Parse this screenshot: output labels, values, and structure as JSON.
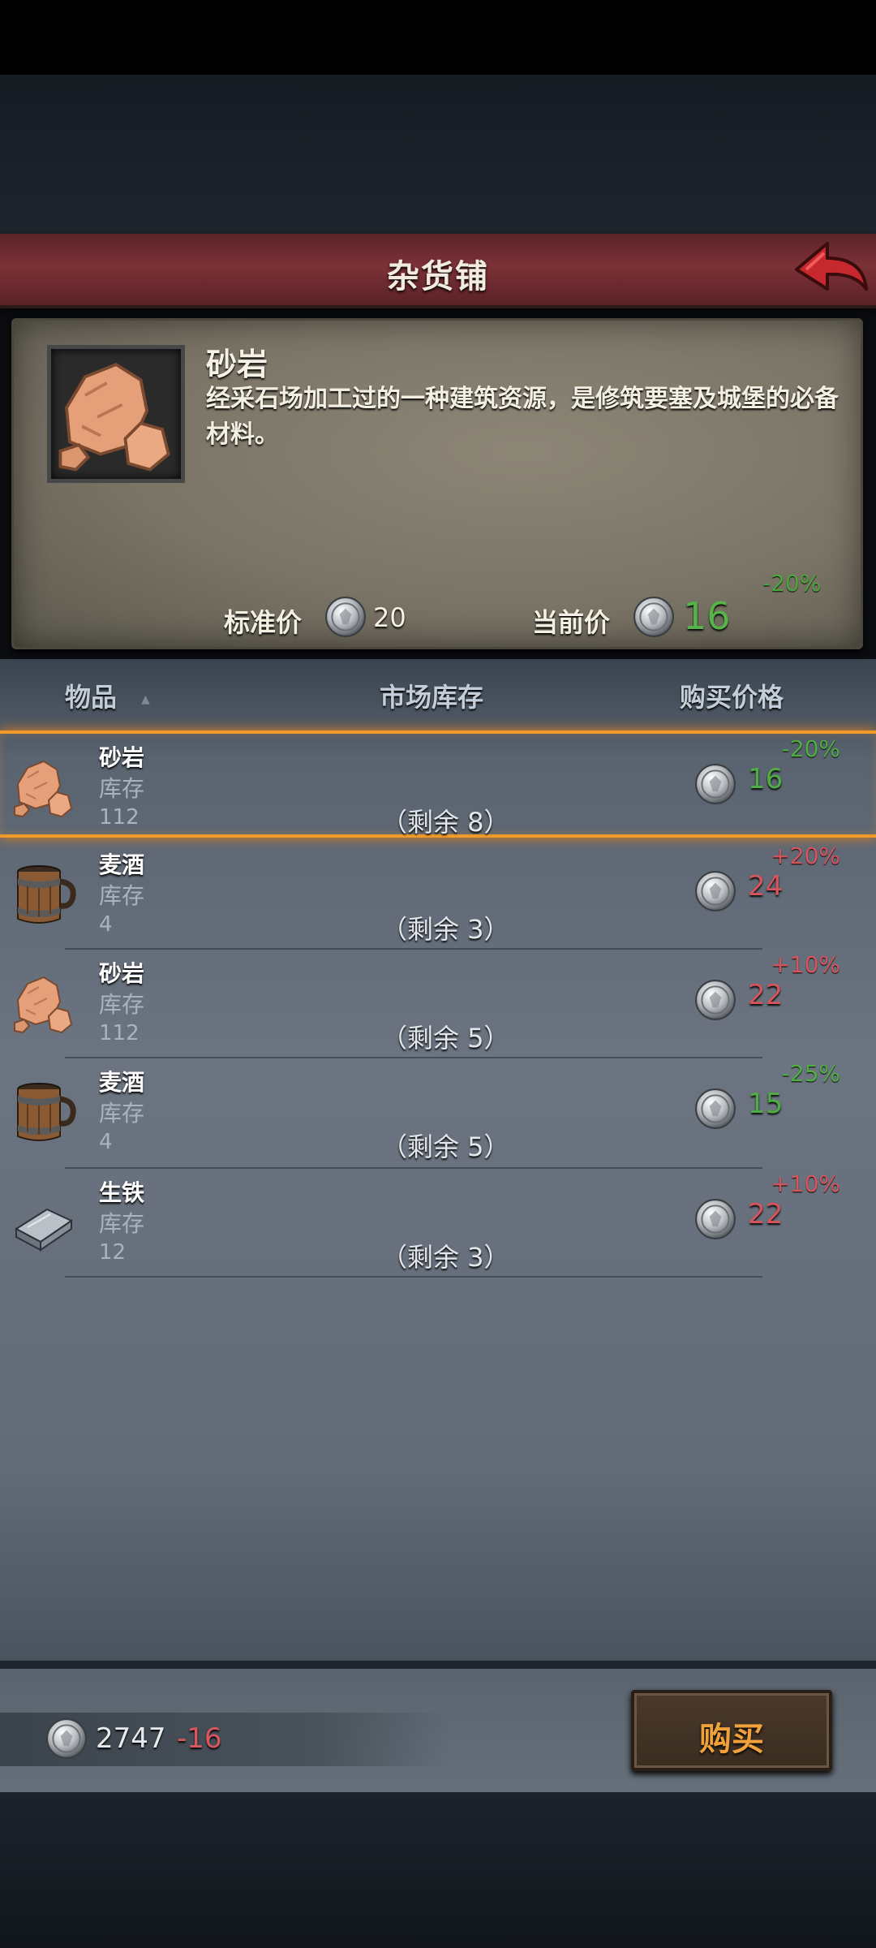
{
  "shop": {
    "title": "杂货铺"
  },
  "detail": {
    "name": "砂岩",
    "description": "经采石场加工过的一种建筑资源，是修筑要塞及城堡的必备材料。",
    "discount": "-20%",
    "standard_price_label": "标准价",
    "standard_price": "20",
    "current_price_label": "当前价",
    "current_price": "16",
    "icon": "sandstone-icon"
  },
  "columns": {
    "item": "物品",
    "stock": "市场库存",
    "price": "购买价格"
  },
  "items": [
    {
      "name": "砂岩",
      "stock_label": "库存",
      "stock": "112",
      "remain": "（剩余 8）",
      "pct": "-20%",
      "price": "16",
      "trend": "down",
      "icon": "sandstone-icon"
    },
    {
      "name": "麦酒",
      "stock_label": "库存",
      "stock": "4",
      "remain": "（剩余 3）",
      "pct": "+20%",
      "price": "24",
      "trend": "up",
      "icon": "ale-mug-icon"
    },
    {
      "name": "砂岩",
      "stock_label": "库存",
      "stock": "112",
      "remain": "（剩余 5）",
      "pct": "+10%",
      "price": "22",
      "trend": "up",
      "icon": "sandstone-icon"
    },
    {
      "name": "麦酒",
      "stock_label": "库存",
      "stock": "4",
      "remain": "（剩余 5）",
      "pct": "-25%",
      "price": "15",
      "trend": "down",
      "icon": "ale-mug-icon"
    },
    {
      "name": "生铁",
      "stock_label": "库存",
      "stock": "12",
      "remain": "（剩余 3）",
      "pct": "+10%",
      "price": "22",
      "trend": "up",
      "icon": "pig-iron-icon"
    }
  ],
  "wallet": {
    "amount": "2747",
    "delta": "-16"
  },
  "buy_button": {
    "label": "购买"
  },
  "colors": {
    "price_up": "#d6545c",
    "price_down": "#4fae42",
    "selection": "#f09a2a",
    "title_bar": "#7c3137"
  }
}
